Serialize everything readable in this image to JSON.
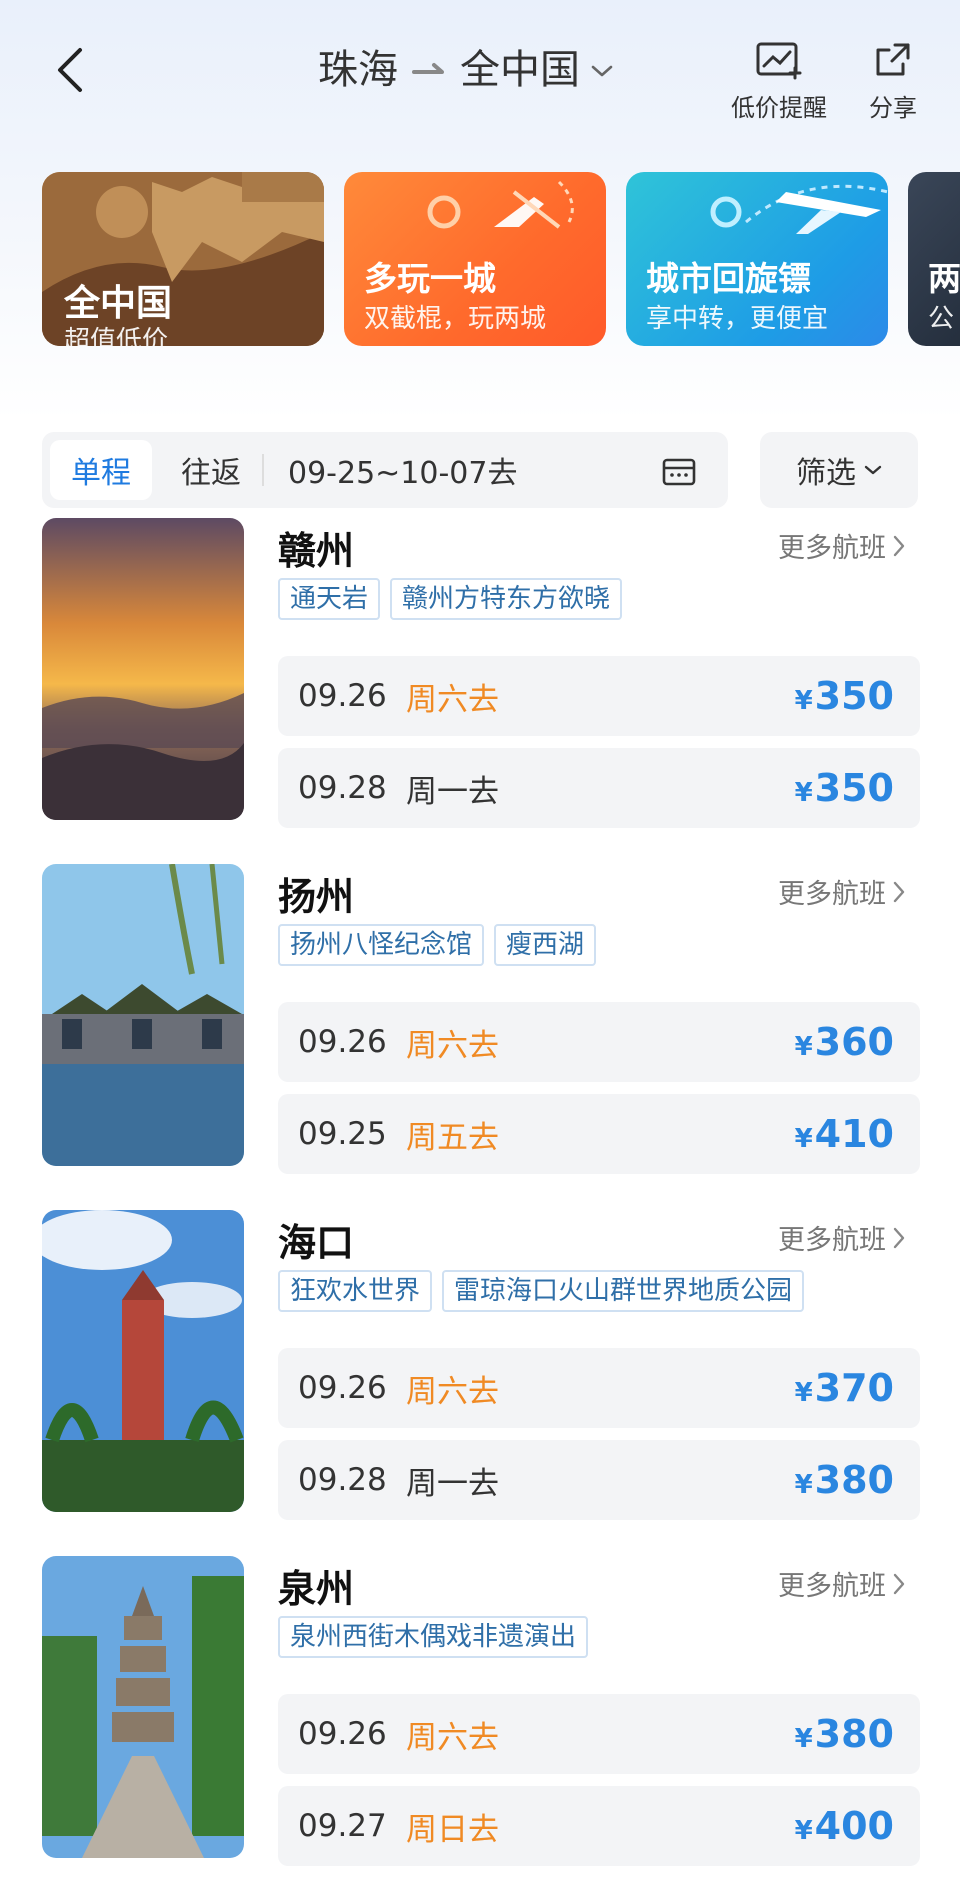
{
  "header": {
    "origin": "珠海",
    "destination": "全中国",
    "price_alert_label": "低价提醒",
    "share_label": "分享",
    "icons": {
      "back": "back-arrow-icon",
      "dropdown": "chevron-down-icon",
      "price_alert": "chart-plus-icon",
      "share": "share-icon"
    }
  },
  "promos": [
    {
      "title": "全中国",
      "subtitle": "超值低价"
    },
    {
      "title": "多玩一城",
      "subtitle": "双截棍，玩两城"
    },
    {
      "title": "城市回旋镖",
      "subtitle": "享中转，更便宜"
    },
    {
      "title": "两",
      "subtitle": "公"
    }
  ],
  "filter": {
    "one_way": "单程",
    "round_trip": "往返",
    "date_range": "09-25~10-07去",
    "filter_label": "筛选",
    "selected_tab": "单程",
    "accent_color": "#1f7be0"
  },
  "destinations": [
    {
      "city": "赣州",
      "more_label": "更多航班",
      "tags": [
        "通天岩",
        "赣州方特东方欲晓"
      ],
      "flights": [
        {
          "date": "09.26",
          "day": "周六去",
          "weekend": true,
          "currency": "¥",
          "price": "350"
        },
        {
          "date": "09.28",
          "day": "周一去",
          "weekend": false,
          "currency": "¥",
          "price": "350"
        }
      ]
    },
    {
      "city": "扬州",
      "more_label": "更多航班",
      "tags": [
        "扬州八怪纪念馆",
        "瘦西湖"
      ],
      "flights": [
        {
          "date": "09.26",
          "day": "周六去",
          "weekend": true,
          "currency": "¥",
          "price": "360"
        },
        {
          "date": "09.25",
          "day": "周五去",
          "weekend": true,
          "currency": "¥",
          "price": "410"
        }
      ]
    },
    {
      "city": "海口",
      "more_label": "更多航班",
      "tags": [
        "狂欢水世界",
        "雷琼海口火山群世界地质公园"
      ],
      "flights": [
        {
          "date": "09.26",
          "day": "周六去",
          "weekend": true,
          "currency": "¥",
          "price": "370"
        },
        {
          "date": "09.28",
          "day": "周一去",
          "weekend": false,
          "currency": "¥",
          "price": "380"
        }
      ]
    },
    {
      "city": "泉州",
      "more_label": "更多航班",
      "tags": [
        "泉州西街木偶戏非遗演出"
      ],
      "flights": [
        {
          "date": "09.26",
          "day": "周六去",
          "weekend": true,
          "currency": "¥",
          "price": "380"
        },
        {
          "date": "09.27",
          "day": "周日去",
          "weekend": true,
          "currency": "¥",
          "price": "400"
        }
      ]
    }
  ],
  "colors": {
    "price": "#2a86e0",
    "weekend_day": "#f08a24",
    "tag_text": "#2f6fa8"
  }
}
